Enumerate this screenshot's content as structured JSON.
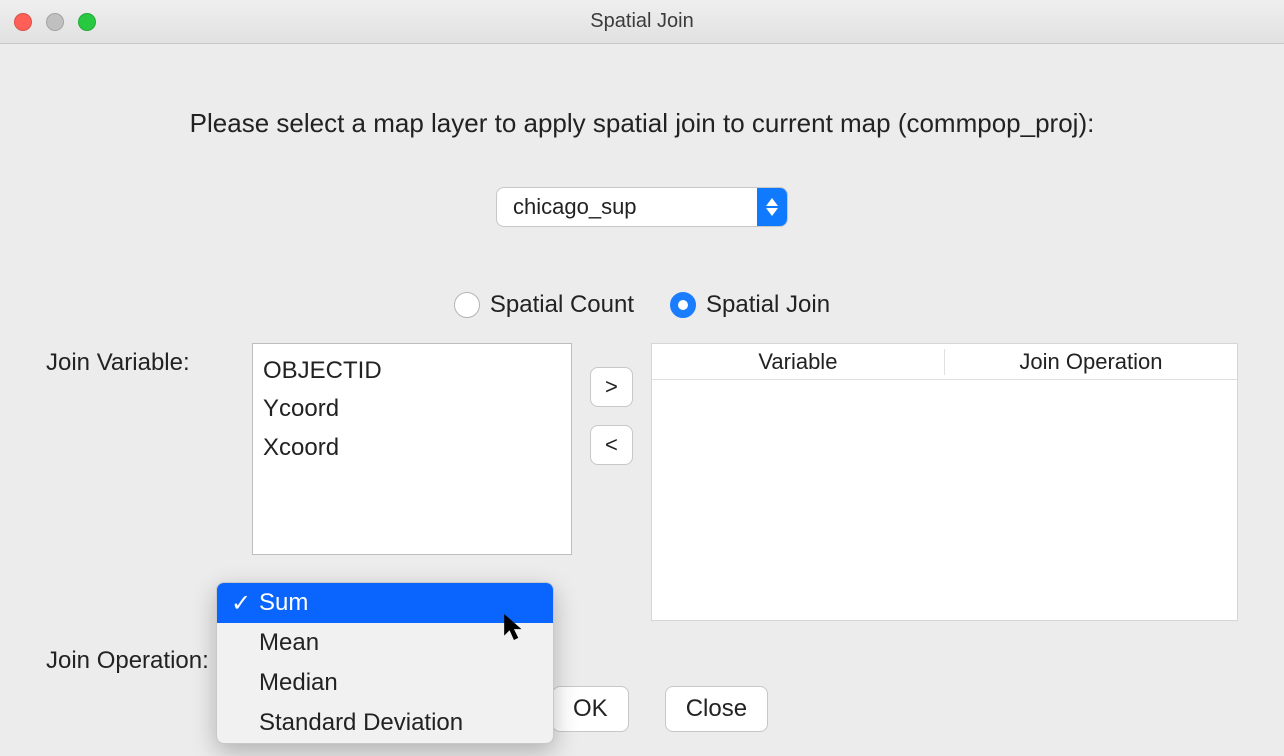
{
  "window": {
    "title": "Spatial Join"
  },
  "instruction": "Please select a map layer to apply spatial join to current map (commpop_proj):",
  "layer_select": {
    "value": "chicago_sup"
  },
  "radio": {
    "spatial_count": "Spatial Count",
    "spatial_join": "Spatial Join",
    "selected": "spatial_join"
  },
  "labels": {
    "join_variable": "Join Variable:",
    "join_operation": "Join Operation:"
  },
  "variables": [
    "OBJECTID",
    "Ycoord",
    "Xcoord"
  ],
  "move": {
    "add": ">",
    "remove": "<"
  },
  "table": {
    "col_variable": "Variable",
    "col_operation": "Join Operation"
  },
  "operation_options": [
    "Sum",
    "Mean",
    "Median",
    "Standard Deviation"
  ],
  "operation_selected": "Sum",
  "buttons": {
    "ok": "OK",
    "close": "Close"
  }
}
